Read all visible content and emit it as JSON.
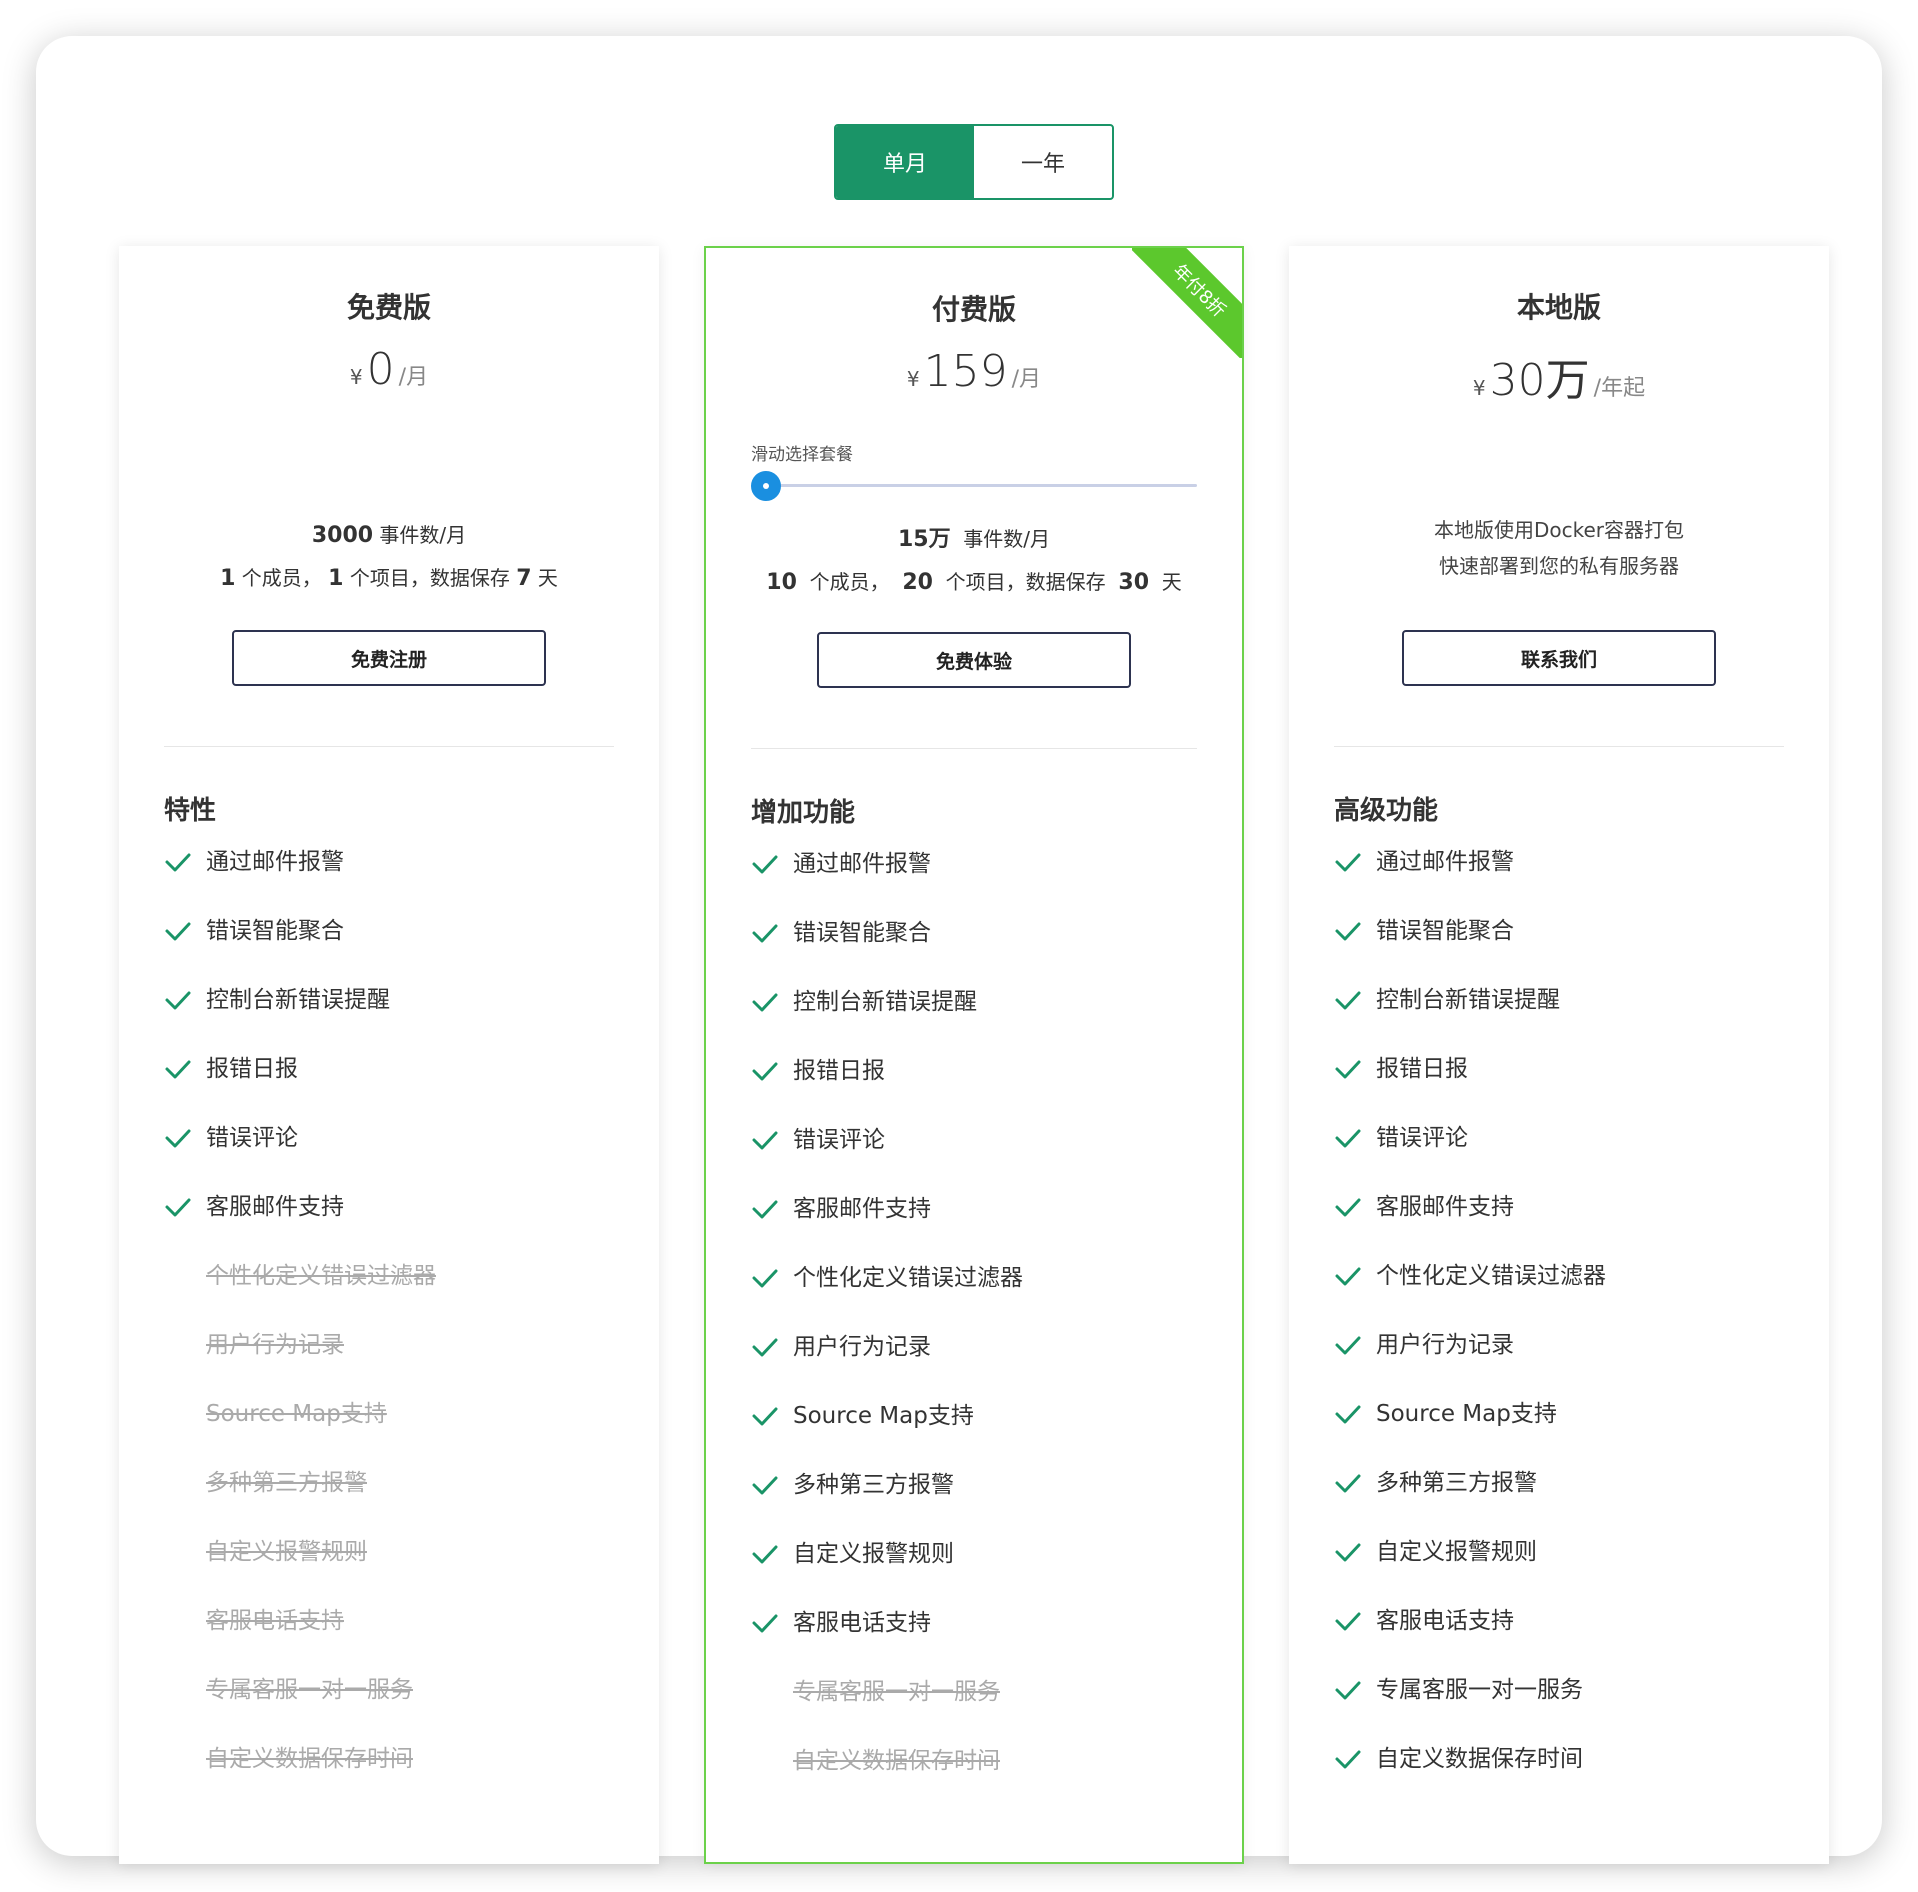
{
  "toggle": {
    "monthly": "单月",
    "yearly": "一年"
  },
  "colors": {
    "accent": "#1a9467",
    "ribbon": "#5cc82d",
    "slider": "#1a8fe0"
  },
  "plans": [
    {
      "title": "免费版",
      "currency": "¥",
      "price": "0",
      "unit": "/月",
      "desc_events_num": "3000",
      "desc_events_unit": "事件数/月",
      "desc_members_num": "1",
      "desc_members_unit": "个成员，",
      "desc_projects_num": "1",
      "desc_projects_unit": "个项目，数据保存",
      "desc_days_num": "7",
      "desc_days_unit": "天",
      "cta": "免费注册",
      "section": "特性",
      "features": [
        {
          "text": "通过邮件报警",
          "on": true
        },
        {
          "text": "错误智能聚合",
          "on": true
        },
        {
          "text": "控制台新错误提醒",
          "on": true
        },
        {
          "text": "报错日报",
          "on": true
        },
        {
          "text": "错误评论",
          "on": true
        },
        {
          "text": "客服邮件支持",
          "on": true
        },
        {
          "text": "个性化定义错误过滤器",
          "on": false
        },
        {
          "text": "用户行为记录",
          "on": false
        },
        {
          "text": "Source Map支持",
          "on": false
        },
        {
          "text": "多种第三方报警",
          "on": false
        },
        {
          "text": "自定义报警规则",
          "on": false
        },
        {
          "text": "客服电话支持",
          "on": false
        },
        {
          "text": "专属客服一对一服务",
          "on": false
        },
        {
          "text": "自定义数据保存时间",
          "on": false
        }
      ]
    },
    {
      "title": "付费版",
      "ribbon": "年付8折",
      "currency": "¥",
      "price": "159",
      "unit": "/月",
      "slider_label": "滑动选择套餐",
      "slider_position": 0,
      "desc_events_num": "15万",
      "desc_events_unit": "事件数/月",
      "desc_members_num": "10",
      "desc_members_unit": "个成员，",
      "desc_projects_num": "20",
      "desc_projects_unit": "个项目，数据保存",
      "desc_days_num": "30",
      "desc_days_unit": "天",
      "cta": "免费体验",
      "section": "增加功能",
      "features": [
        {
          "text": "通过邮件报警",
          "on": true
        },
        {
          "text": "错误智能聚合",
          "on": true
        },
        {
          "text": "控制台新错误提醒",
          "on": true
        },
        {
          "text": "报错日报",
          "on": true
        },
        {
          "text": "错误评论",
          "on": true
        },
        {
          "text": "客服邮件支持",
          "on": true
        },
        {
          "text": "个性化定义错误过滤器",
          "on": true
        },
        {
          "text": "用户行为记录",
          "on": true
        },
        {
          "text": "Source Map支持",
          "on": true
        },
        {
          "text": "多种第三方报警",
          "on": true
        },
        {
          "text": "自定义报警规则",
          "on": true
        },
        {
          "text": "客服电话支持",
          "on": true
        },
        {
          "text": "专属客服一对一服务",
          "on": false
        },
        {
          "text": "自定义数据保存时间",
          "on": false
        }
      ]
    },
    {
      "title": "本地版",
      "currency": "¥",
      "price": "30万",
      "unit": "/年起",
      "desc_line1": "本地版使用Docker容器打包",
      "desc_line2": "快速部署到您的私有服务器",
      "cta": "联系我们",
      "section": "高级功能",
      "features": [
        {
          "text": "通过邮件报警",
          "on": true
        },
        {
          "text": "错误智能聚合",
          "on": true
        },
        {
          "text": "控制台新错误提醒",
          "on": true
        },
        {
          "text": "报错日报",
          "on": true
        },
        {
          "text": "错误评论",
          "on": true
        },
        {
          "text": "客服邮件支持",
          "on": true
        },
        {
          "text": "个性化定义错误过滤器",
          "on": true
        },
        {
          "text": "用户行为记录",
          "on": true
        },
        {
          "text": "Source Map支持",
          "on": true
        },
        {
          "text": "多种第三方报警",
          "on": true
        },
        {
          "text": "自定义报警规则",
          "on": true
        },
        {
          "text": "客服电话支持",
          "on": true
        },
        {
          "text": "专属客服一对一服务",
          "on": true
        },
        {
          "text": "自定义数据保存时间",
          "on": true
        }
      ]
    }
  ],
  "icons": {
    "check": "check-icon"
  }
}
